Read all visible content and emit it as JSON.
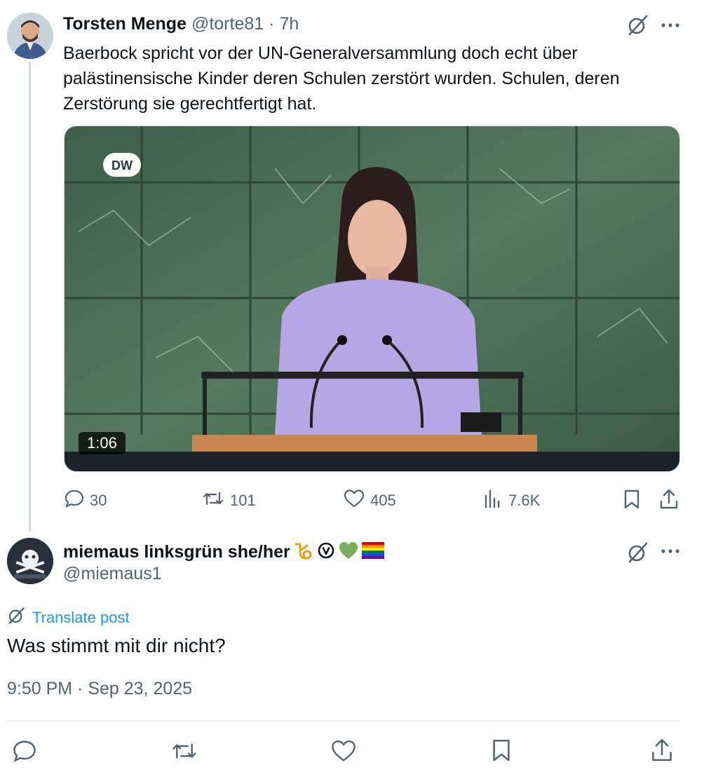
{
  "original_post": {
    "display_name": "Torsten Menge",
    "handle": "@torte81",
    "separator": "·",
    "time_ago": "7h",
    "text": "Baerbock spricht vor der UN-Generalversammlung doch echt über palästinensische Kinder deren Schulen zerstört wurden. Schulen, deren Zerstörung sie gerechtfertigt hat.",
    "media": {
      "logo_text": "DW",
      "duration": "1:06"
    },
    "stats": {
      "replies": "30",
      "reposts": "101",
      "likes": "405",
      "views": "7.6K"
    }
  },
  "reply_post": {
    "display_name": "miemaus linksgrün she/her",
    "handle": "@miemaus1",
    "translate_label": "Translate post",
    "text": "Was stimmt mit dir nicht?",
    "timestamp": "9:50 PM · Sep 23, 2025"
  },
  "colors": {
    "text_primary": "#0f1419",
    "text_secondary": "#536471",
    "link": "#1d9bf0",
    "divider": "#e6ecf0"
  },
  "icons": {
    "grok": "grok-icon",
    "more": "more-icon",
    "reply": "reply-icon",
    "repost": "repost-icon",
    "like": "heart-icon",
    "views": "views-icon",
    "bookmark": "bookmark-icon",
    "share": "share-icon"
  }
}
